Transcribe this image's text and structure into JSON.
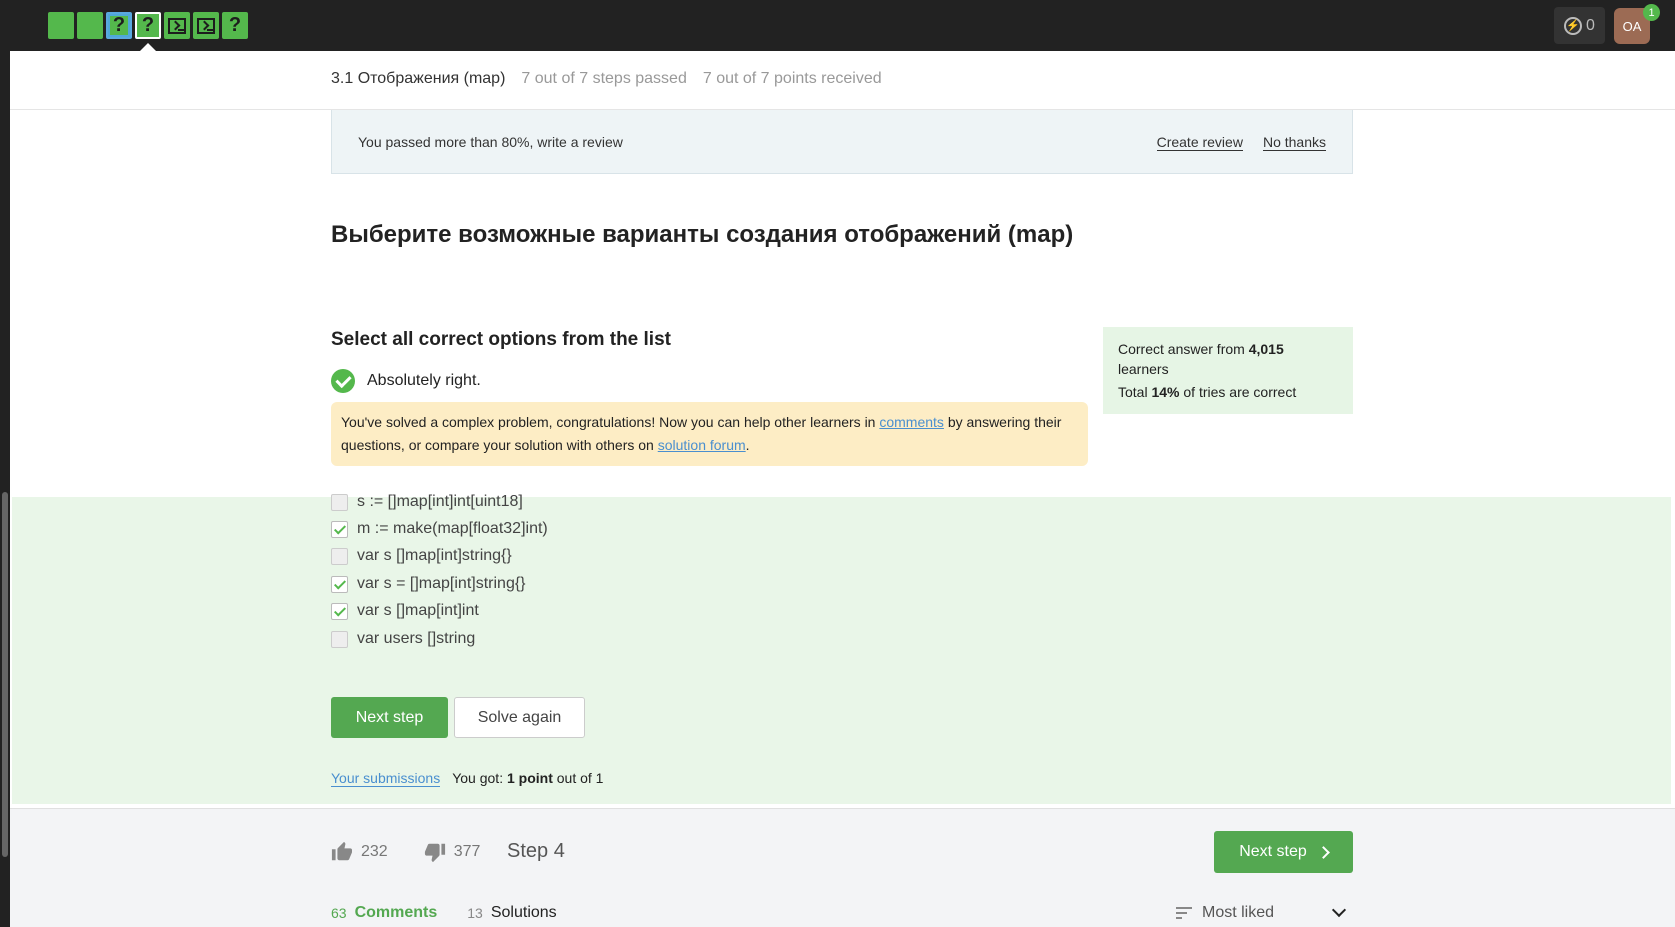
{
  "topbar": {
    "steps": [
      {
        "type": "text",
        "glyph": "",
        "state": "passed"
      },
      {
        "type": "text",
        "glyph": "",
        "state": "passed"
      },
      {
        "type": "quiz",
        "glyph": "?",
        "state": "active"
      },
      {
        "type": "quiz",
        "glyph": "?",
        "state": "current"
      },
      {
        "type": "code",
        "glyph": "",
        "state": "passed"
      },
      {
        "type": "code",
        "glyph": "",
        "state": "passed"
      },
      {
        "type": "quiz",
        "glyph": "?",
        "state": "passed"
      }
    ],
    "energy": "0",
    "avatar_initials": "OA",
    "notification_count": "1",
    "accent": "#54b84c"
  },
  "lesson": {
    "title": "3.1 Отображения (map)",
    "steps_passed": "7 out of 7 steps passed",
    "points": "7 out of 7 points  received"
  },
  "review": {
    "message": "You passed more than 80%, write a review",
    "create": "Create review",
    "no_thanks": "No thanks"
  },
  "question": {
    "title": "Выберите возможные варианты создания отображений (map)",
    "instruction": "Select all correct options from the list",
    "status": "Absolutely right."
  },
  "congrats": {
    "part1": "You've solved a complex problem, congratulations! Now you can help other learners in ",
    "link1": "comments",
    "part2": " by answering their questions, or compare your solution with others on ",
    "link2": "solution forum",
    "part3": "."
  },
  "stats": {
    "line1_prefix": "Correct answer from ",
    "learners_count": "4,015",
    "line1_suffix": " learners",
    "line2_prefix": "Total ",
    "percent": "14%",
    "line2_suffix": " of tries are correct"
  },
  "options": [
    {
      "text": "s := []map[int]int[uint18]",
      "checked": false
    },
    {
      "text": "m := make(map[float32]int)",
      "checked": true
    },
    {
      "text": "var s []map[int]string{}",
      "checked": false
    },
    {
      "text": "var s = []map[int]string{}",
      "checked": true
    },
    {
      "text": "var s []map[int]int",
      "checked": true
    },
    {
      "text": "var users []string",
      "checked": false
    }
  ],
  "actions": {
    "next_step": "Next step",
    "solve_again": "Solve again"
  },
  "result": {
    "submissions_link": "Your submissions",
    "got_prefix": "You got: ",
    "got_points": "1 point",
    "got_suffix": " out of 1"
  },
  "footer": {
    "likes": "232",
    "dislikes": "377",
    "step_label": "Step 4",
    "next_step": "Next step",
    "comments_count": "63",
    "comments_label": "Comments",
    "solutions_count": "13",
    "solutions_label": "Solutions",
    "sort_label": "Most liked"
  }
}
